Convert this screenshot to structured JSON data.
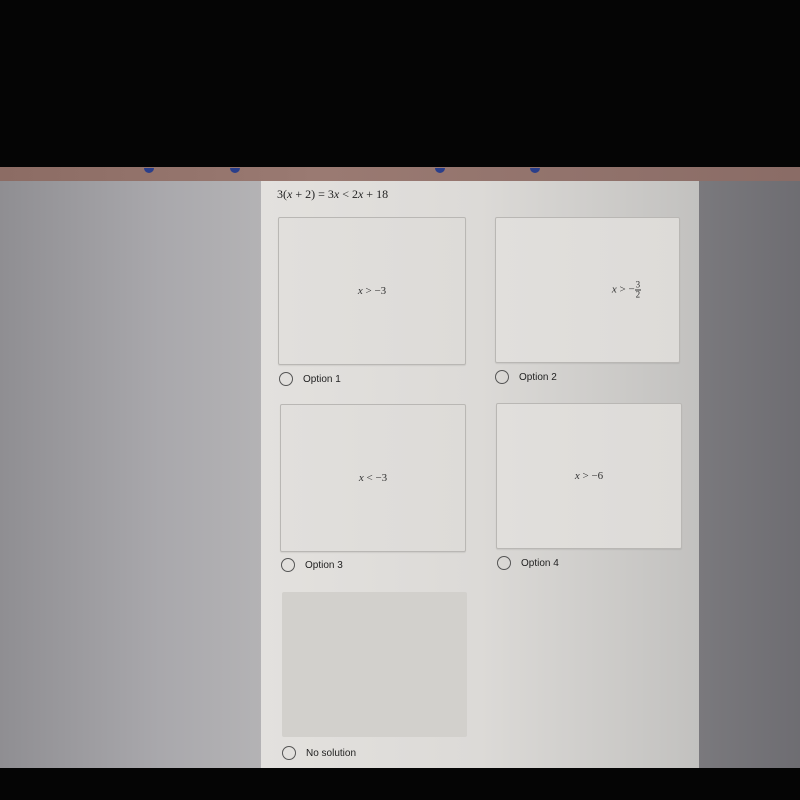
{
  "question": {
    "text_parts": {
      "a": "3(",
      "x1": "x",
      "b": " + 2) = 3",
      "x2": "x",
      "c": " < 2",
      "x3": "x",
      "d": " + 18"
    }
  },
  "options": [
    {
      "label": "Option 1",
      "math": {
        "var": "x",
        "rel": " > −3"
      }
    },
    {
      "label": "Option 2",
      "math": {
        "var": "x",
        "rel": " > −",
        "frac_num": "3",
        "frac_den": "2"
      }
    },
    {
      "label": "Option 3",
      "math": {
        "var": "x",
        "rel": " < −3"
      }
    },
    {
      "label": "Option 4",
      "math": {
        "var": "x",
        "rel": " > −6"
      }
    },
    {
      "label": "No solution",
      "math": null
    }
  ],
  "colors": {
    "page_bg": "#dcdad7",
    "toolbar": "#9a7a72",
    "card_border": "#b9b7b4",
    "text": "#222222"
  }
}
